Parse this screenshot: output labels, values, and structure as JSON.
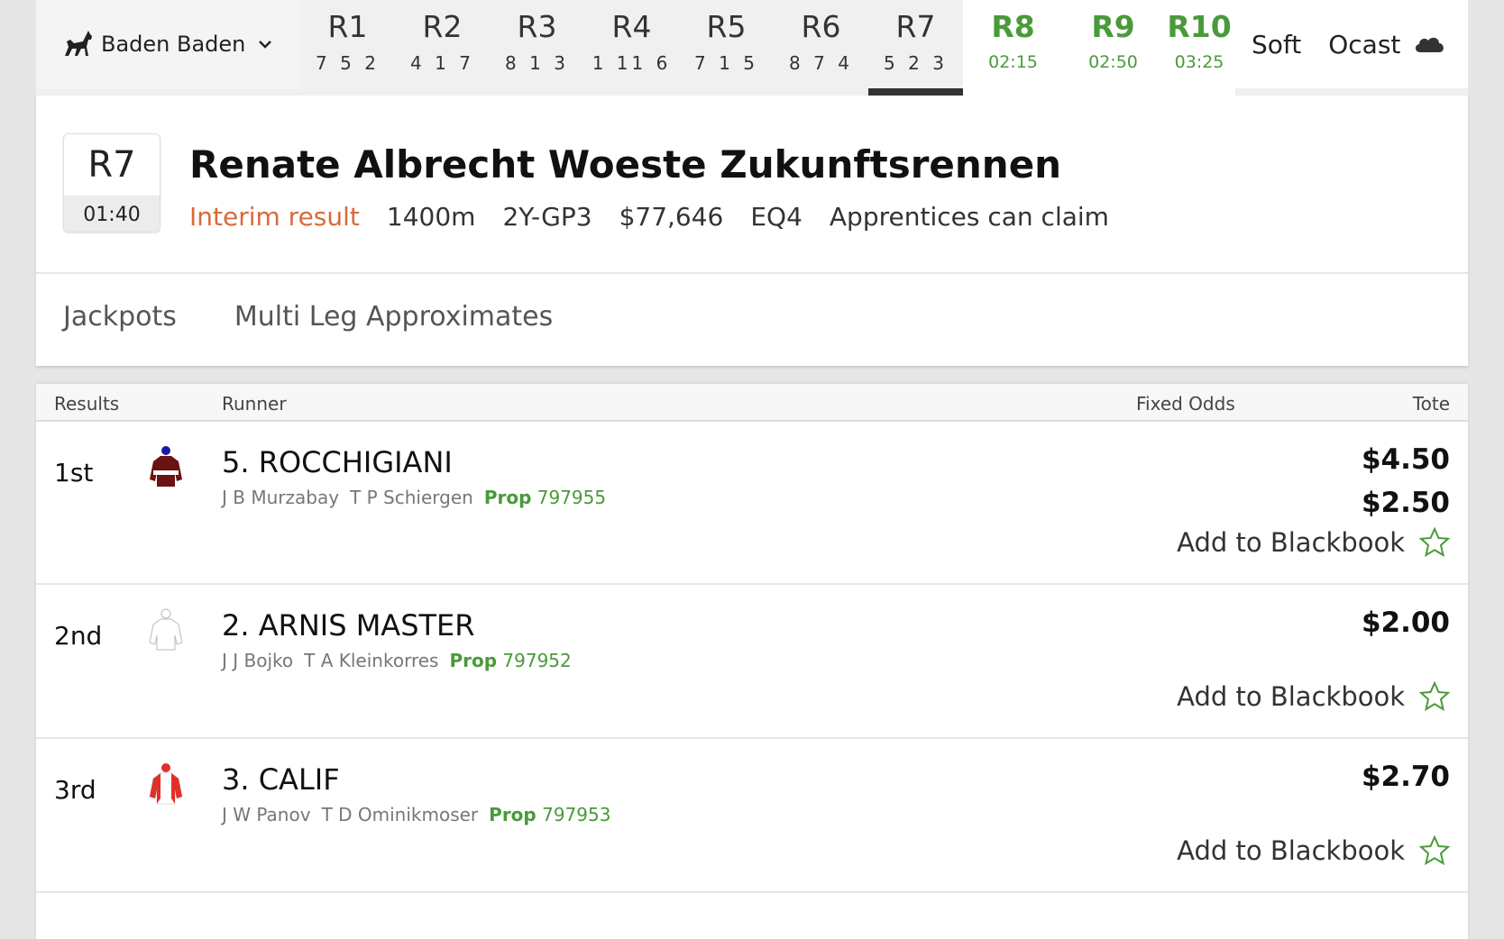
{
  "venue": {
    "name": "Baden Baden"
  },
  "races": [
    {
      "label": "R1",
      "sub": "7 5 2",
      "state": "done"
    },
    {
      "label": "R2",
      "sub": "4 1 7",
      "state": "done"
    },
    {
      "label": "R3",
      "sub": "8 1 3",
      "state": "done"
    },
    {
      "label": "R4",
      "sub": "1 11 6",
      "state": "done"
    },
    {
      "label": "R5",
      "sub": "7 1 5",
      "state": "done"
    },
    {
      "label": "R6",
      "sub": "8 7 4",
      "state": "done"
    },
    {
      "label": "R7",
      "sub": "5 2 3",
      "state": "active"
    },
    {
      "label": "R8",
      "sub": "02:15",
      "state": "upcoming"
    },
    {
      "label": "R9",
      "sub": "02:50",
      "state": "upcoming"
    },
    {
      "label": "R10",
      "sub": "03:25",
      "state": "upcoming"
    }
  ],
  "conditions": {
    "track": "Soft",
    "weather": "Ocast"
  },
  "race": {
    "number": "R7",
    "time": "01:40",
    "title": "Renate Albrecht Woeste Zukunftsrennen",
    "status": "Interim result",
    "distance": "1400m",
    "class": "2Y-GP3",
    "prize": "$77,646",
    "eq": "EQ4",
    "note": "Apprentices can claim"
  },
  "subtabs": {
    "jackpots": "Jackpots",
    "multi": "Multi Leg Approximates"
  },
  "results_head": {
    "results": "Results",
    "runner": "Runner",
    "fixed": "Fixed Odds",
    "tote": "Tote"
  },
  "runners": [
    {
      "place": "1st",
      "name": "5. ROCCHIGIANI",
      "jockey": "J B Murzabay",
      "trainer": "T P Schiergen",
      "prop_label": "Prop",
      "prop": "797955",
      "tote_win": "$4.50",
      "tote_place": "$2.50",
      "blackbook": "Add to Blackbook"
    },
    {
      "place": "2nd",
      "name": "2. ARNIS MASTER",
      "jockey": "J J Bojko",
      "trainer": "T A Kleinkorres",
      "prop_label": "Prop",
      "prop": "797952",
      "tote_place": "$2.00",
      "blackbook": "Add to Blackbook"
    },
    {
      "place": "3rd",
      "name": "3. CALIF",
      "jockey": "J W Panov",
      "trainer": "T D Ominikmoser",
      "prop_label": "Prop",
      "prop": "797953",
      "tote_place": "$2.70",
      "blackbook": "Add to Blackbook"
    }
  ],
  "colors": {
    "accent_green": "#4a9a3a",
    "status_orange": "#d86a3a"
  }
}
